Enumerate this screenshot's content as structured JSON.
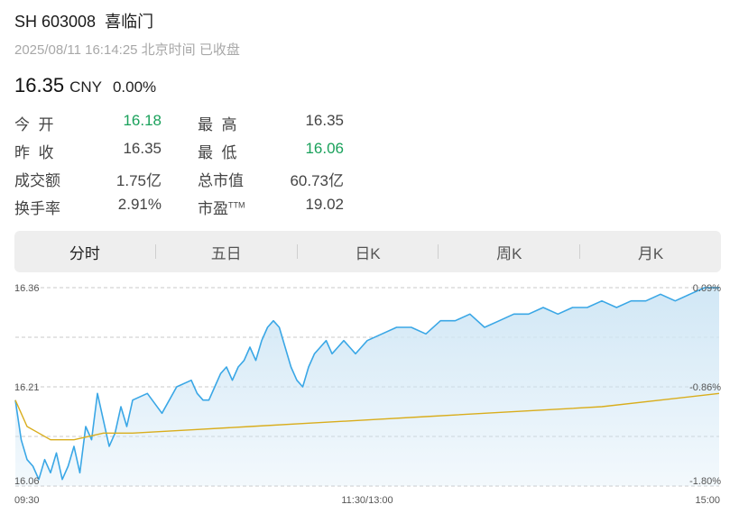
{
  "header": {
    "title": "SH 603008  喜临门",
    "subtitle": "2025/08/11 16:14:25 北京时间 已收盘",
    "price": "16.35",
    "currency": "CNY",
    "change": "0.00%"
  },
  "stats": {
    "open_label": "今  开",
    "open_value": "16.18",
    "high_label": "最  高",
    "high_value": "16.35",
    "prev_close_label": "昨  收",
    "prev_close_value": "16.35",
    "low_label": "最  低",
    "low_value": "16.06",
    "turnover_label": "成交额",
    "turnover_value": "1.75亿",
    "market_cap_label": "总市值",
    "market_cap_value": "60.73亿",
    "turnover_rate_label": "换手率",
    "turnover_rate_value": "2.91%",
    "pe_label": "市盈",
    "pe_label_sup": "TTM",
    "pe_value": "19.02"
  },
  "tabs": [
    {
      "label": "分时",
      "active": true
    },
    {
      "label": "五日",
      "active": false
    },
    {
      "label": "日K",
      "active": false
    },
    {
      "label": "周K",
      "active": false
    },
    {
      "label": "月K",
      "active": false
    }
  ],
  "colors": {
    "green": "#1aa15b",
    "price_line": "#3aa7e6",
    "avg_line": "#d9ad1c",
    "area_fill": "#cfe6f5",
    "grid": "#c9c9c9"
  },
  "chart_data": {
    "type": "area",
    "y_ticks_left": [
      "16.36",
      "16.21",
      "16.06"
    ],
    "y_ticks_right": [
      "0.09%",
      "-0.86%",
      "-1.80%"
    ],
    "x_ticks": [
      "09:30",
      "11:30/13:00",
      "15:00"
    ],
    "ylim": [
      16.06,
      16.36
    ],
    "grid": true,
    "series": [
      {
        "kind": "price",
        "x": [
          0,
          2,
          4,
          6,
          8,
          10,
          12,
          14,
          16,
          18,
          20,
          22,
          24,
          26,
          28,
          30,
          32,
          34,
          36,
          38,
          40,
          45,
          50,
          55,
          60,
          62,
          64,
          66,
          68,
          70,
          72,
          74,
          76,
          78,
          80,
          82,
          84,
          86,
          88,
          90,
          92,
          94,
          96,
          98,
          100,
          102,
          104,
          106,
          108,
          110,
          112,
          114,
          116,
          118,
          120,
          125,
          130,
          135,
          140,
          145,
          150,
          155,
          160,
          165,
          170,
          175,
          180,
          185,
          190,
          195,
          200,
          205,
          210,
          215,
          220,
          225,
          230,
          235,
          240
        ],
        "values": [
          16.19,
          16.13,
          16.1,
          16.09,
          16.07,
          16.1,
          16.08,
          16.11,
          16.07,
          16.09,
          16.12,
          16.08,
          16.15,
          16.13,
          16.2,
          16.16,
          16.12,
          16.14,
          16.18,
          16.15,
          16.19,
          16.2,
          16.17,
          16.21,
          16.22,
          16.2,
          16.19,
          16.19,
          16.21,
          16.23,
          16.24,
          16.22,
          16.24,
          16.25,
          16.27,
          16.25,
          16.28,
          16.3,
          16.31,
          16.3,
          16.27,
          16.24,
          16.22,
          16.21,
          16.24,
          16.26,
          16.27,
          16.28,
          16.26,
          16.27,
          16.28,
          16.27,
          16.26,
          16.27,
          16.28,
          16.29,
          16.3,
          16.3,
          16.29,
          16.31,
          16.31,
          16.32,
          16.3,
          16.31,
          16.32,
          16.32,
          16.33,
          16.32,
          16.33,
          16.33,
          16.34,
          16.33,
          16.34,
          16.34,
          16.35,
          16.34,
          16.35,
          16.36,
          16.36
        ]
      },
      {
        "kind": "average",
        "x": [
          0,
          4,
          8,
          12,
          20,
          30,
          40,
          60,
          80,
          100,
          120,
          140,
          160,
          180,
          200,
          220,
          240
        ],
        "values": [
          16.19,
          16.15,
          16.14,
          16.13,
          16.13,
          16.14,
          16.14,
          16.145,
          16.15,
          16.155,
          16.16,
          16.165,
          16.17,
          16.175,
          16.18,
          16.19,
          16.2
        ]
      }
    ]
  }
}
